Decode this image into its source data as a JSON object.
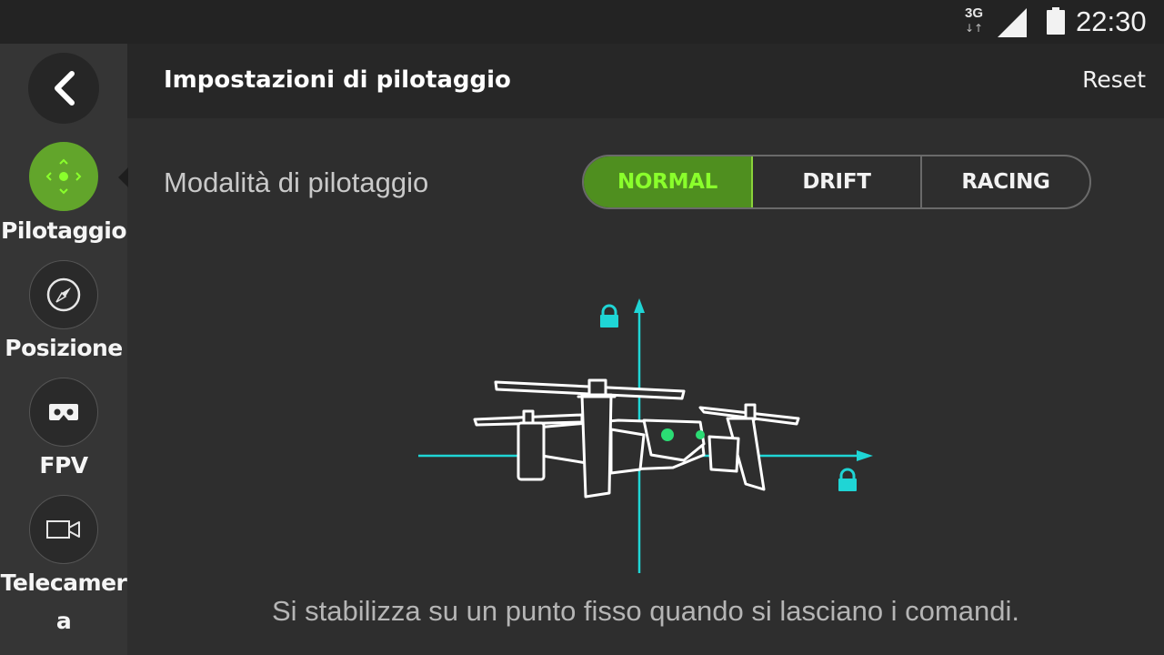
{
  "status_bar": {
    "network": "3G",
    "network_arrows": "↓↑",
    "time": "22:30"
  },
  "sidebar": {
    "items": [
      {
        "label": "Pilotaggio",
        "icon": "piloting-dpad-icon",
        "active": true
      },
      {
        "label": "Posizione",
        "icon": "compass-icon",
        "active": false
      },
      {
        "label": "FPV",
        "icon": "vr-headset-icon",
        "active": false
      },
      {
        "label": "Telecamer\na",
        "icon": "video-camera-icon",
        "active": false
      }
    ]
  },
  "header": {
    "title": "Impostazioni di pilotaggio",
    "reset_label": "Reset"
  },
  "piloting_mode": {
    "label": "Modalità di pilotaggio",
    "options": [
      "NORMAL",
      "DRIFT",
      "RACING"
    ],
    "selected": "NORMAL",
    "description": "Si stabilizza su un punto fisso quando si lasciano i comandi."
  },
  "colors": {
    "accent_green": "#62a52b",
    "selected_text_green": "#8aff2c",
    "axis_cyan": "#1fd5d5",
    "background": "#2e2e2e"
  }
}
